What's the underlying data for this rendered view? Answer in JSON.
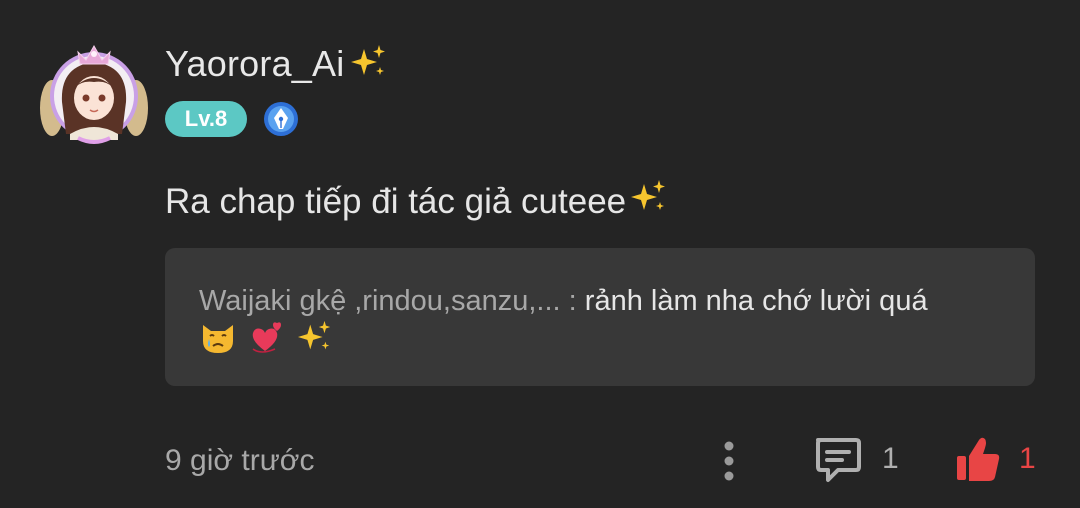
{
  "user": {
    "name": "Yaorora_Ai",
    "name_emoji_icon": "sparkles-icon",
    "level": "Lv.8",
    "level_color": "#5cc8c4",
    "badge_icon": "pen-nib-badge-icon"
  },
  "comment": {
    "text": "Ra chap tiếp đi tác giả cuteee",
    "text_emoji_icon": "sparkles-icon"
  },
  "reply": {
    "author": "Waijaki gkệ ,rindou,sanzu,... :",
    "text": "rảnh làm nha chớ lười quá",
    "emoji_icons": [
      "crying-cat-icon",
      "revolving-hearts-icon",
      "sparkles-icon"
    ]
  },
  "footer": {
    "time": "9 giờ trước",
    "more_icon": "vertical-dots-icon",
    "comment_icon": "comment-bubble-icon",
    "comment_count": "1",
    "like_icon": "thumbs-up-icon",
    "like_count": "1",
    "like_color": "#e84545"
  }
}
